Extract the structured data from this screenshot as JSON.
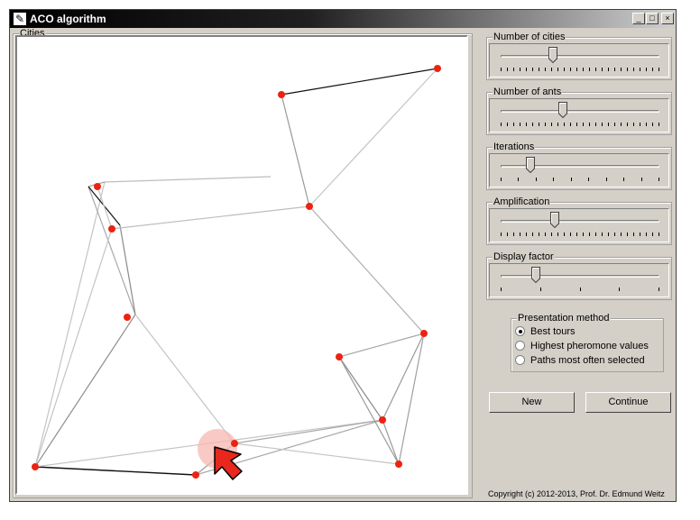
{
  "window": {
    "title": "ACO algorithm",
    "minimize_label": "_",
    "maximize_label": "□",
    "close_label": "×"
  },
  "canvas": {
    "title": "Cities"
  },
  "sliders": [
    {
      "label": "Number of cities",
      "value": 0.33
    },
    {
      "label": "Number of ants",
      "value": 0.39
    },
    {
      "label": "Iterations",
      "value": 0.19
    },
    {
      "label": "Amplification",
      "value": 0.34
    },
    {
      "label": "Display factor",
      "value": 0.22
    }
  ],
  "presentation": {
    "title": "Presentation method",
    "options": [
      {
        "label": "Best tours",
        "checked": true
      },
      {
        "label": "Highest pheromone values",
        "checked": false
      },
      {
        "label": "Paths most often selected",
        "checked": false
      }
    ]
  },
  "buttons": {
    "new_label": "New",
    "continue_label": "Continue"
  },
  "footer": {
    "copyright": "Copyright (c) 2012-2013, Prof. Dr. Edmund Weitz"
  },
  "colors": {
    "city": "#ee2211",
    "cursor": "#e8281c",
    "highlight": "#f7b7b0"
  }
}
